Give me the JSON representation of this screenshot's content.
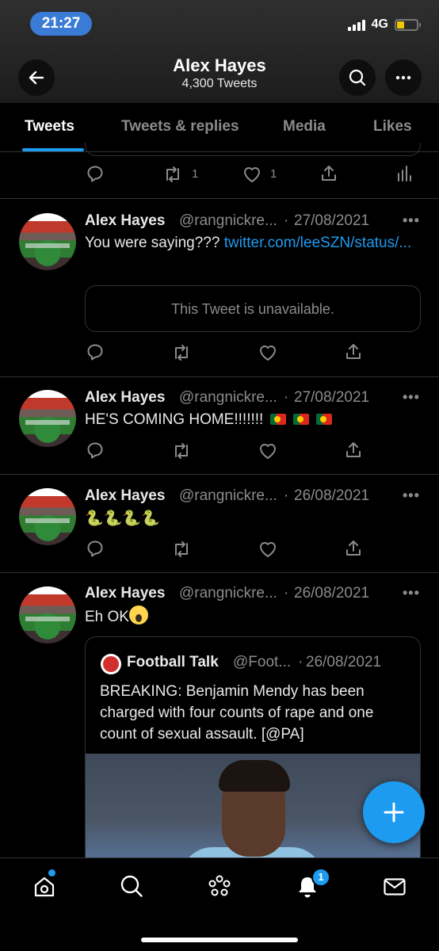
{
  "status_bar": {
    "time": "21:27",
    "network": "4G"
  },
  "header": {
    "title": "Alex Hayes",
    "subtitle": "4,300 Tweets"
  },
  "tabs": [
    {
      "label": "Tweets",
      "active": true
    },
    {
      "label": "Tweets & replies"
    },
    {
      "label": "Media"
    },
    {
      "label": "Likes"
    }
  ],
  "partial_tweet": {
    "retweets": "1",
    "likes": "1"
  },
  "tweets": [
    {
      "name": "Alex Hayes",
      "handle": "@rangnickre...",
      "date": "27/08/2021",
      "text": "You were saying??? ",
      "link": "twitter.com/leeSZN/status/...",
      "unavailable": "This Tweet is unavailable."
    },
    {
      "name": "Alex Hayes",
      "handle": "@rangnickre...",
      "date": "27/08/2021",
      "text": "HE'S COMING HOME!!!!!!!"
    },
    {
      "name": "Alex Hayes",
      "handle": "@rangnickre...",
      "date": "26/08/2021",
      "text": "🐍🐍🐍🐍"
    },
    {
      "name": "Alex Hayes",
      "handle": "@rangnickre...",
      "date": "26/08/2021",
      "text": "Eh OK"
    }
  ],
  "quote": {
    "name": "Football Talk",
    "handle": "@Foot...",
    "date": "26/08/2021",
    "text": "BREAKING: Benjamin Mendy has been charged with four counts of rape and one count of sexual assault. [@PA]"
  },
  "more_glyph": "•••",
  "dot_sep": "·",
  "bottom_nav": {
    "notification_count": "1"
  },
  "colors": {
    "accent": "#1d9bf0",
    "background": "#000000",
    "muted": "#8b8b8b"
  },
  "icons": [
    "back-arrow-icon",
    "search-icon",
    "more-icon",
    "reply-icon",
    "retweet-icon",
    "like-icon",
    "share-icon",
    "analytics-icon",
    "compose-icon",
    "home-icon",
    "spaces-icon",
    "notifications-icon",
    "messages-icon"
  ]
}
